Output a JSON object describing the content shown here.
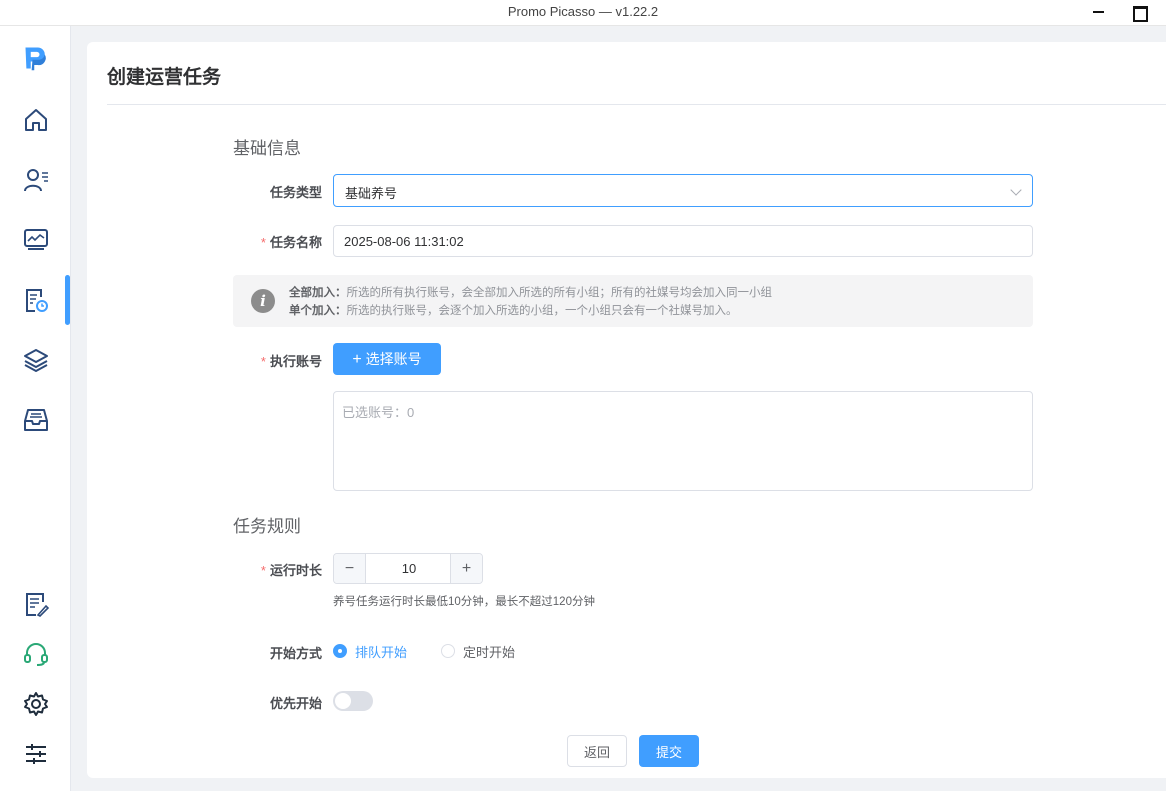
{
  "window": {
    "title": "Promo Picasso — v1.22.2"
  },
  "sidebar": {
    "items": [
      {
        "icon": "logo-icon"
      },
      {
        "icon": "home-icon"
      },
      {
        "icon": "user-list-icon"
      },
      {
        "icon": "monitor-icon"
      },
      {
        "icon": "task-schedule-icon",
        "active": true
      },
      {
        "icon": "layers-icon"
      },
      {
        "icon": "inbox-icon"
      },
      {
        "icon": "note-edit-icon"
      },
      {
        "icon": "headset-icon"
      },
      {
        "icon": "gear-icon"
      },
      {
        "icon": "sliders-icon"
      }
    ]
  },
  "page": {
    "title": "创建运营任务"
  },
  "basic": {
    "section_title": "基础信息",
    "task_type_label": "任务类型",
    "task_type_value": "基础养号",
    "task_name_label": "任务名称",
    "task_name_value": "2025-08-06 11:31:02",
    "tip_line1_title": "全部加入：",
    "tip_line1_text": "所选的所有执行账号，会全部加入所选的所有小组；所有的社媒号均会加入同一小组",
    "tip_line2_title": "单个加入：",
    "tip_line2_text": "所选的执行账号，会逐个加入所选的小组，一个小组只会有一个社媒号加入。",
    "account_label": "执行账号",
    "select_account_button": "选择账号",
    "selected_accounts_text": "已选账号：0"
  },
  "rules": {
    "section_title": "任务规则",
    "duration_label": "运行时长",
    "duration_value": "10",
    "duration_hint": "养号任务运行时长最低10分钟，最长不超过120分钟",
    "start_mode_label": "开始方式",
    "start_options": [
      "排队开始",
      "定时开始"
    ],
    "start_selected": "排队开始",
    "priority_label": "优先开始",
    "priority_enabled": false
  },
  "actions": {
    "back_label": "返回",
    "submit_label": "提交"
  },
  "colors": {
    "primary": "#409eff",
    "required": "#f56c6c"
  }
}
